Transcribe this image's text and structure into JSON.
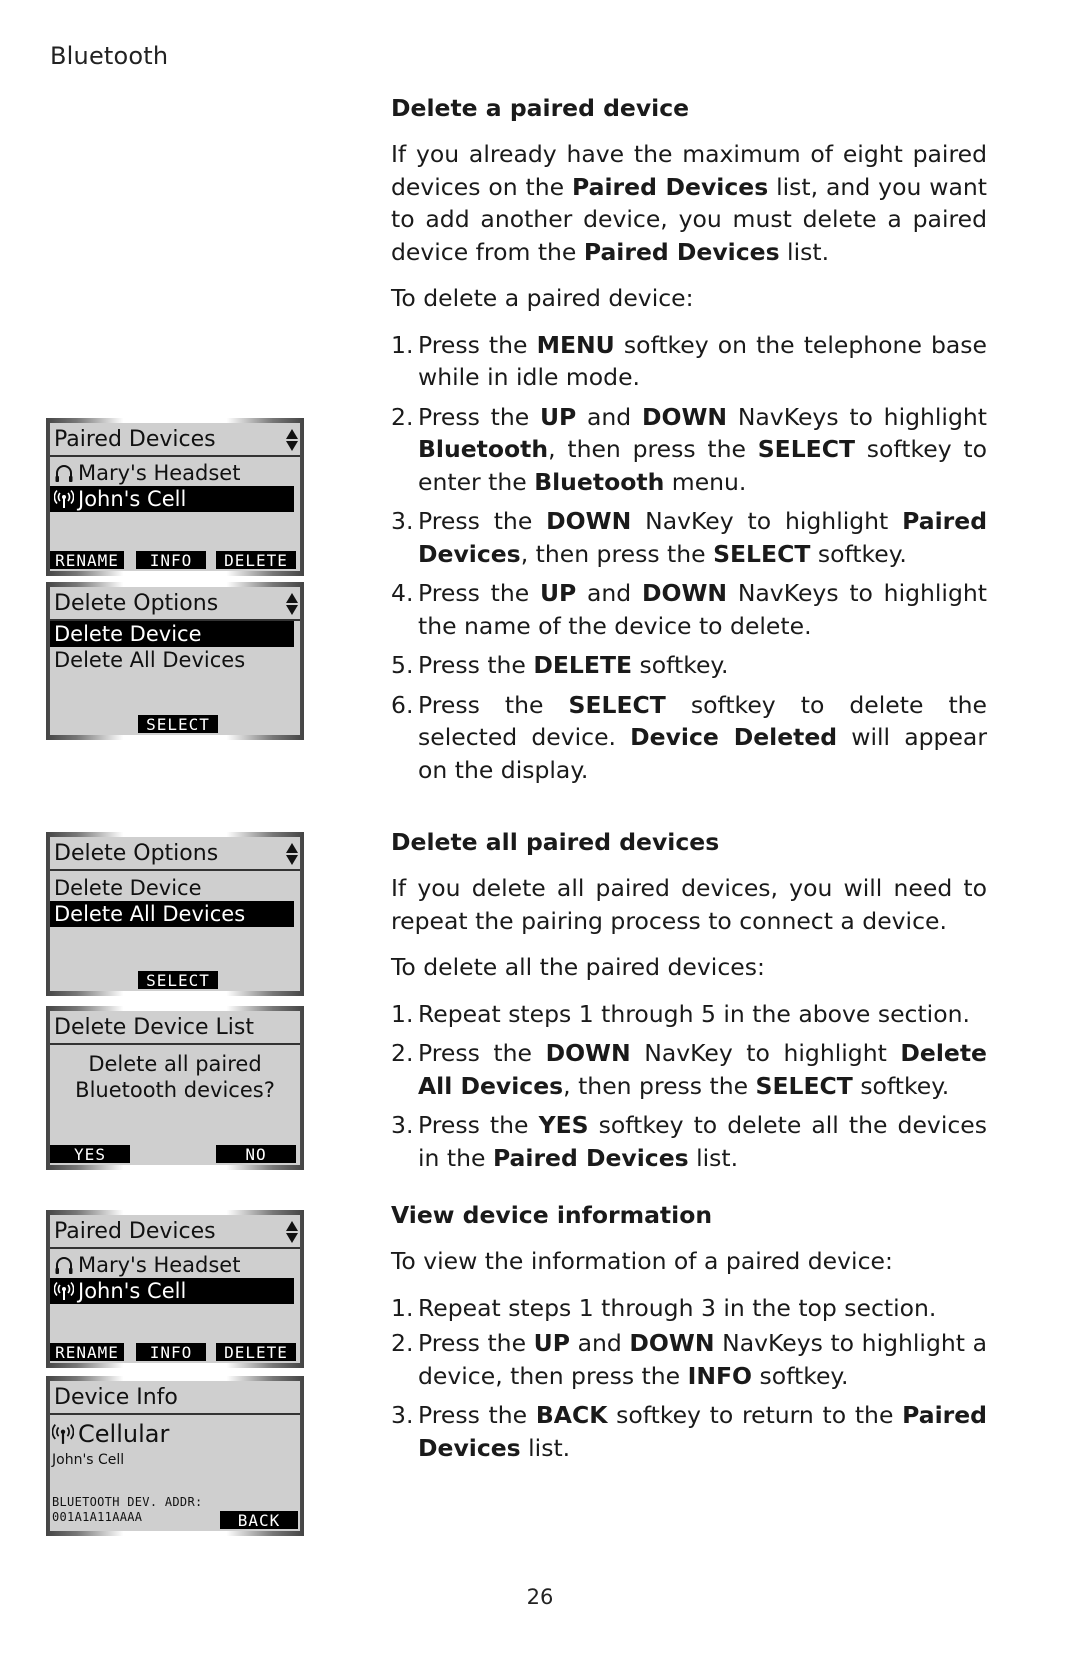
{
  "running_head": "Bluetooth",
  "page_number": "26",
  "screens": [
    {
      "title": "Paired Devices",
      "rows": [
        {
          "icon": "headset-icon",
          "text": "Mary's Headset",
          "highlighted": false
        },
        {
          "icon": "cellular-icon",
          "text": "John's Cell",
          "highlighted": true
        }
      ],
      "softkeys": [
        "RENAME",
        "INFO",
        "DELETE"
      ]
    },
    {
      "title": "Delete Options",
      "rows": [
        {
          "text": "Delete Device",
          "highlighted": true
        },
        {
          "text": "Delete All Devices",
          "highlighted": false
        }
      ],
      "softkeys": [
        "SELECT"
      ]
    },
    {
      "title": "Delete Options",
      "rows": [
        {
          "text": "Delete Device",
          "highlighted": false
        },
        {
          "text": "Delete All Devices",
          "highlighted": true
        }
      ],
      "softkeys": [
        "SELECT"
      ]
    },
    {
      "title": "Delete Device List",
      "message": [
        "Delete all paired",
        "Bluetooth devices?"
      ],
      "softkeys": [
        "YES",
        "NO"
      ]
    },
    {
      "title": "Paired Devices",
      "rows": [
        {
          "icon": "headset-icon",
          "text": "Mary's Headset",
          "highlighted": false
        },
        {
          "icon": "cellular-icon",
          "text": "John's Cell",
          "highlighted": true
        }
      ],
      "softkeys": [
        "RENAME",
        "INFO",
        "DELETE"
      ]
    },
    {
      "title": "Device Info",
      "type": "Cellular",
      "name": "John's Cell",
      "addr_label": "BLUETOOTH DEV. ADDR:",
      "addr_value": "001A1A11AAAA",
      "softkeys": [
        "BACK"
      ]
    }
  ],
  "sections": [
    {
      "heading": "Delete a paired device",
      "intro": "If you already have the maximum of eight paired devices on the <b>Paired Devices</b> list, and you want to add another device, you must delete a paired device from the <b>Paired Devices</b> list.",
      "lead": "To delete a paired device:",
      "steps": [
        "Press the <b>MENU</b> softkey on the telephone base while in idle mode.",
        "Press the <b>UP</b> and <b>DOWN</b> NavKeys to highlight <b>Bluetooth</b>, then press the <b>SELECT</b> softkey to enter the <b>Bluetooth</b> menu.",
        "Press the <b>DOWN</b> NavKey to highlight <b>Paired Devices</b>, then press the <b>SELECT</b> softkey.",
        "Press the <b>UP</b> and <b>DOWN</b> NavKeys to highlight the name of the device to delete.",
        "Press the <b>DELETE</b> softkey.",
        "Press the <b>SELECT</b> softkey to delete the selected device. <b>Device Deleted</b> will appear on the display."
      ]
    },
    {
      "heading": "Delete all paired devices",
      "intro": "If you delete all paired devices, you will need to repeat the pairing process to connect a device.",
      "lead": "To delete all the paired devices:",
      "steps": [
        "Repeat steps 1 through 5 in the above section.",
        "Press the <b>DOWN</b> NavKey to highlight <b>Delete All Devices</b>, then press the <b>SELECT</b> softkey.",
        "Press the <b>YES</b> softkey to delete all the devices in the <b>Paired Devices</b> list."
      ]
    },
    {
      "heading": "View device information",
      "lead": "To view the information of a paired device:",
      "steps": [
        "Repeat steps 1 through 3 in the top section.",
        "Press the <b>UP</b> and <b>DOWN</b> NavKeys to highlight a device, then press the <b>INFO</b> softkey.",
        "Press the <b>BACK</b> softkey to return to the <b>Paired Devices</b> list."
      ]
    }
  ]
}
